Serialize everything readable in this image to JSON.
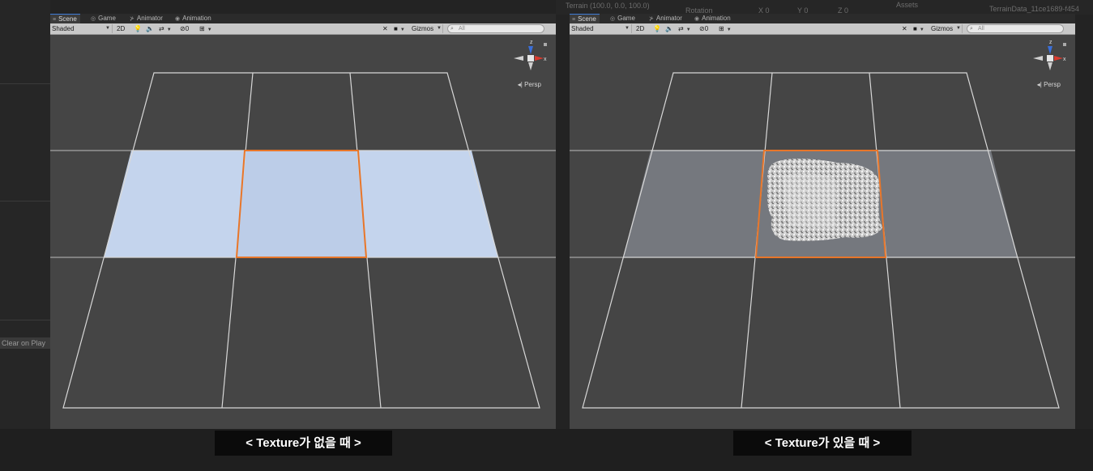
{
  "colors": {
    "viewport_bg": "#454545",
    "grid_line": "#cfcfcf",
    "selection": "#e8762a",
    "untextured_terrain": "#c2d3ec",
    "textured_terrain": "#777a80",
    "caption_bg": "#0b0b0b"
  },
  "background": {
    "clear_on_play": "Clear on Play",
    "inspector_fragments": [
      "Terrain (100.0, 0.0, 100.0)",
      "Rotation",
      "X 0",
      "Y 0",
      "Z 0",
      "Assets",
      "TerrainData_11ce1689-f454"
    ]
  },
  "tabs": [
    {
      "icon": "scene-icon",
      "glyph": "≡",
      "label": "Scene"
    },
    {
      "icon": "game-icon",
      "glyph": "◎",
      "label": "Game"
    },
    {
      "icon": "animator-icon",
      "glyph": "⊁",
      "label": "Animator"
    },
    {
      "icon": "animation-icon",
      "glyph": "◉",
      "label": "Animation"
    }
  ],
  "toolbar": {
    "shading_mode": "Shaded",
    "mode_2d": "2D",
    "fx_count": "0",
    "gizmos": "Gizmos",
    "search_placeholder": "All"
  },
  "gizmo": {
    "z_label": "z",
    "x_label": "x",
    "projection": "Persp"
  },
  "scenes": [
    {
      "caption": "< Texture가 없을 때 >",
      "terrain": "untextured"
    },
    {
      "caption": "< Texture가 있을 때 >",
      "terrain": "textured"
    }
  ]
}
